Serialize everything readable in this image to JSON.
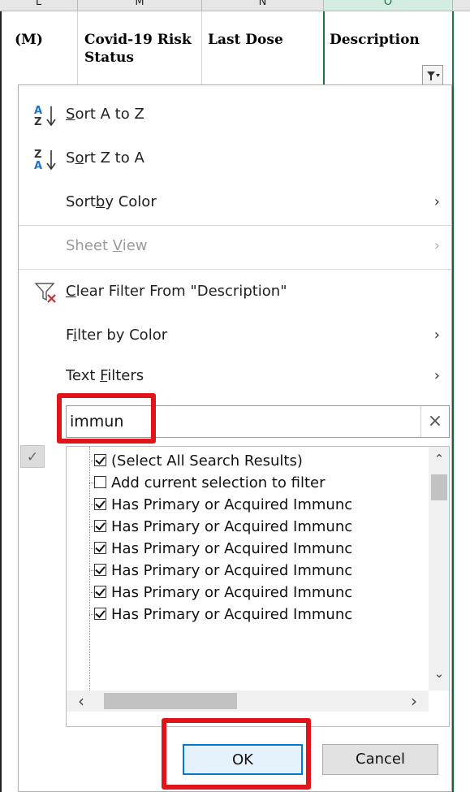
{
  "columns": {
    "letters": [
      "L",
      "M",
      "N",
      "O"
    ],
    "headers": [
      {
        "text": "(M)"
      },
      {
        "text": "Covid-19 Risk Status"
      },
      {
        "text": "Last Dose"
      },
      {
        "text": "Description"
      }
    ]
  },
  "menu": {
    "sort_a_z": {
      "pre": "",
      "u": "S",
      "post": "ort A to Z"
    },
    "sort_z_a": {
      "pre": "S",
      "u": "o",
      "post": "rt Z to A"
    },
    "sort_by_color": {
      "pre": "Sort",
      "u": "",
      "u2": "b",
      "post": "y Color"
    },
    "sheet_view": {
      "pre": "Sheet ",
      "u": "V",
      "post": "iew"
    },
    "clear_filter": {
      "pre": "",
      "u": "C",
      "post": "lear Filter From \"Description\""
    },
    "filter_by_color": {
      "pre": "F",
      "u": "i",
      "post": "lter by Color"
    },
    "text_filters": {
      "pre": "Text ",
      "u": "F",
      "post": "ilters"
    }
  },
  "search": {
    "value": "immun",
    "clear_symbol": "×"
  },
  "list": [
    {
      "label": "(Select All Search Results)",
      "checked": true
    },
    {
      "label": "Add current selection to filter",
      "checked": false
    },
    {
      "label": "Has Primary or Acquired Immunc",
      "checked": true
    },
    {
      "label": "Has Primary or Acquired Immunc",
      "checked": true
    },
    {
      "label": "Has Primary or Acquired Immunc",
      "checked": true
    },
    {
      "label": "Has Primary or Acquired Immunc",
      "checked": true
    },
    {
      "label": "Has Primary or Acquired Immunc",
      "checked": true
    },
    {
      "label": "Has Primary or Acquired Immunc",
      "checked": true
    }
  ],
  "buttons": {
    "ok": "OK",
    "cancel": "Cancel"
  },
  "icons": {
    "filter_button": "filter-dropdown-icon",
    "sort_asc": "sort-ascending-icon",
    "sort_desc": "sort-descending-icon",
    "clear_filter": "clear-filter-icon",
    "chevron": "chevron-right-icon",
    "check": "check-icon"
  },
  "colors": {
    "highlight": "#e0151b",
    "accent": "#217346",
    "ok_border": "#0078d7"
  }
}
